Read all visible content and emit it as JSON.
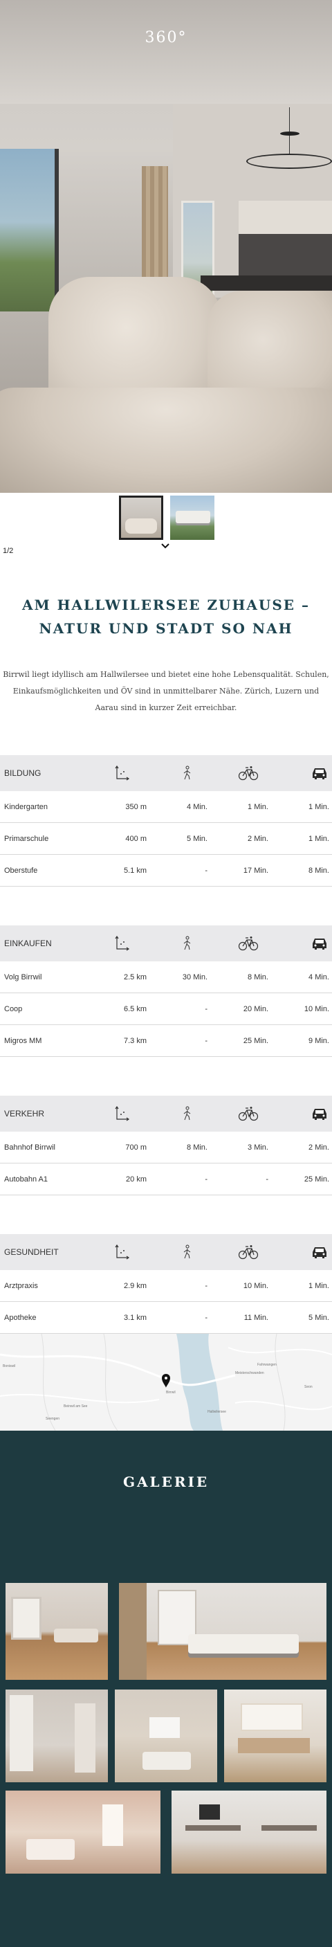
{
  "hero": {
    "label": "360°"
  },
  "slider": {
    "counter": "1/2"
  },
  "intro": {
    "title_line1": "AM HALLWILERSEE ZUHAUSE –",
    "title_line2": "NATUR UND STADT SO NAH",
    "text_line1": "Birrwil liegt idyllisch am Hallwilersee und bietet eine hohe Lebensqualität. Schulen,",
    "text_line2": "Einkaufsmöglichkeiten und ÖV sind in unmittelbarer Nähe. Zürich, Luzern und",
    "text_line3": "Aarau sind in kurzer Zeit erreichbar."
  },
  "icons": [
    "distance-icon",
    "walk-icon",
    "bike-icon",
    "car-icon"
  ],
  "tables": [
    {
      "title": "BILDUNG",
      "rows": [
        [
          "Kindergarten",
          "350 m",
          "4 Min.",
          "1 Min.",
          "1 Min."
        ],
        [
          "Primarschule",
          "400 m",
          "5 Min.",
          "2 Min.",
          "1 Min."
        ],
        [
          "Oberstufe",
          "5.1 km",
          "-",
          "17 Min.",
          "8 Min."
        ]
      ]
    },
    {
      "title": "EINKAUFEN",
      "rows": [
        [
          "Volg Birrwil",
          "2.5 km",
          "30 Min.",
          "8 Min.",
          "4 Min."
        ],
        [
          "Coop",
          "6.5 km",
          "-",
          "20 Min.",
          "10 Min."
        ],
        [
          "Migros MM",
          "7.3 km",
          "-",
          "25 Min.",
          "9 Min."
        ]
      ]
    },
    {
      "title": "VERKEHR",
      "rows": [
        [
          "Bahnhof Birrwil",
          "700 m",
          "8 Min.",
          "3 Min.",
          "2 Min."
        ],
        [
          "Autobahn A1",
          "20 km",
          "-",
          "-",
          "25 Min."
        ]
      ]
    },
    {
      "title": "GESUNDHEIT",
      "rows": [
        [
          "Arztpraxis",
          "2.9 km",
          "-",
          "10 Min.",
          "1 Min."
        ],
        [
          "Apotheke",
          "3.1 km",
          "-",
          "11 Min.",
          "5 Min."
        ]
      ]
    }
  ],
  "map": {
    "labels": [
      "Boniswil",
      "Birrwil",
      "Meisterschwanden",
      "Fahrwangen",
      "Hallwilersee",
      "Beinwil am See",
      "Seengen",
      "Seon"
    ]
  },
  "gallery": {
    "title": "GALERIE"
  }
}
